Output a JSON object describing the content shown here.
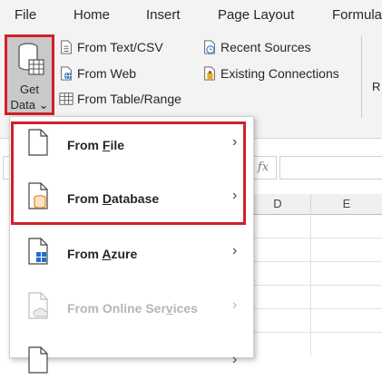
{
  "menu_tabs": [
    "File",
    "Home",
    "Insert",
    "Page Layout",
    "Formula"
  ],
  "ribbon": {
    "get_data": {
      "line1": "Get",
      "line2": "Data",
      "caret": "⌄",
      "icon": "database-table-icon"
    },
    "commands": [
      {
        "label": "From Text/CSV",
        "icon": "text-file-icon"
      },
      {
        "label": "From Web",
        "icon": "web-file-icon"
      },
      {
        "label": "From Table/Range",
        "icon": "table-range-icon"
      },
      {
        "label": "Recent Sources",
        "icon": "recent-sources-icon"
      },
      {
        "label": "Existing Connections",
        "icon": "existing-connections-icon"
      }
    ],
    "truncated_group": "R"
  },
  "formula_bar": {
    "fx": "fx"
  },
  "columns": [
    "D",
    "E"
  ],
  "dropdown": {
    "items": [
      {
        "pre": "From ",
        "accel": "F",
        "post": "ile",
        "icon": "file-icon",
        "enabled": true
      },
      {
        "pre": "From ",
        "accel": "D",
        "post": "atabase",
        "icon": "database-file-icon",
        "enabled": true
      },
      {
        "pre": "From ",
        "accel": "A",
        "post": "zure",
        "icon": "azure-file-icon",
        "enabled": true
      },
      {
        "pre": "From Online Ser",
        "accel": "v",
        "post": "ices",
        "icon": "online-services-icon",
        "enabled": false
      },
      {
        "pre": "",
        "accel": "",
        "post": "",
        "icon": "file-icon",
        "enabled": true
      }
    ],
    "chevron": "›"
  },
  "colors": {
    "highlight": "#d1202a",
    "ribbon_bg": "#f3f3f3",
    "selected_button": "#c9c9c9"
  }
}
